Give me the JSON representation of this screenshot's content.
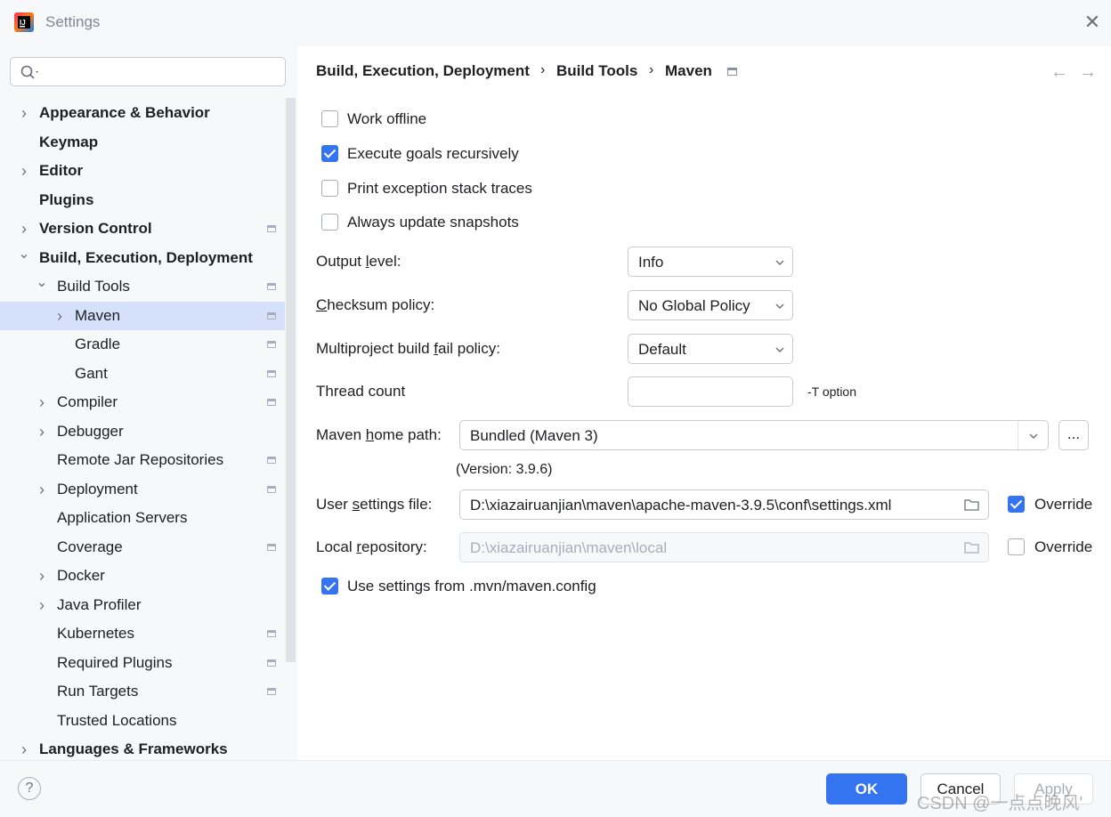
{
  "window": {
    "title": "Settings"
  },
  "search": {
    "placeholder": ""
  },
  "sidebar": {
    "items": [
      {
        "label": "Appearance & Behavior",
        "bold": true,
        "chevron": "right"
      },
      {
        "label": "Keymap",
        "bold": true
      },
      {
        "label": "Editor",
        "bold": true,
        "chevron": "right"
      },
      {
        "label": "Plugins",
        "bold": true
      },
      {
        "label": "Version Control",
        "bold": true,
        "chevron": "right"
      },
      {
        "label": "Build, Execution, Deployment",
        "bold": true,
        "chevron": "down"
      },
      {
        "label": "Build Tools",
        "chevron": "down"
      },
      {
        "label": "Maven",
        "chevron": "right",
        "selected": true
      },
      {
        "label": "Gradle"
      },
      {
        "label": "Gant"
      },
      {
        "label": "Compiler",
        "chevron": "right"
      },
      {
        "label": "Debugger",
        "chevron": "right"
      },
      {
        "label": "Remote Jar Repositories"
      },
      {
        "label": "Deployment",
        "chevron": "right"
      },
      {
        "label": "Application Servers"
      },
      {
        "label": "Coverage"
      },
      {
        "label": "Docker",
        "chevron": "right"
      },
      {
        "label": "Java Profiler",
        "chevron": "right"
      },
      {
        "label": "Kubernetes"
      },
      {
        "label": "Required Plugins"
      },
      {
        "label": "Run Targets"
      },
      {
        "label": "Trusted Locations"
      },
      {
        "label": "Languages & Frameworks",
        "bold": true,
        "chevron": "right"
      }
    ]
  },
  "breadcrumb": {
    "parts": [
      "Build, Execution, Deployment",
      "Build Tools",
      "Maven"
    ],
    "separator": "›"
  },
  "options": {
    "work_offline": {
      "label": "Work offline",
      "checked": false
    },
    "execute_goals": {
      "label": "Execute goals recursively",
      "checked": true
    },
    "print_exception": {
      "label": "Print exception stack traces",
      "checked": false
    },
    "always_update": {
      "label": "Always update snapshots",
      "checked": false
    }
  },
  "output_level": {
    "label_pre": "Output ",
    "label_u": "l",
    "label_post": "evel:",
    "value": "Info"
  },
  "checksum_policy": {
    "label_pre": "",
    "label_u": "C",
    "label_post": "hecksum policy:",
    "value": "No Global Policy"
  },
  "multiproject": {
    "label_pre": "Multiproject build ",
    "label_u": "f",
    "label_post": "ail policy:",
    "value": "Default"
  },
  "thread_count": {
    "label": "Thread count",
    "value": "",
    "hint": "-T option"
  },
  "maven_home": {
    "label_pre": "Maven ",
    "label_u": "h",
    "label_post": "ome path:",
    "value": "Bundled (Maven 3)",
    "browse": "...",
    "version": "(Version: 3.9.6)"
  },
  "user_settings": {
    "label_pre": "User ",
    "label_u": "s",
    "label_post": "ettings file:",
    "value": "D:\\xiazairuanjian\\maven\\apache-maven-3.9.5\\conf\\settings.xml",
    "override_label": "Override",
    "override_checked": true
  },
  "local_repo": {
    "label_pre": "Local ",
    "label_u": "r",
    "label_post": "epository:",
    "value": "D:\\xiazairuanjian\\maven\\local",
    "override_label": "Override",
    "override_checked": false
  },
  "use_mvn_config": {
    "label": "Use settings from .mvn/maven.config",
    "checked": true
  },
  "footer": {
    "help": "?",
    "ok": "OK",
    "cancel": "Cancel",
    "apply": "Apply"
  },
  "watermark": "CSDN @一点点晚风'",
  "colors": {
    "accent": "#3574f0",
    "selection": "#d5e1fb",
    "panel": "#f7f8fa"
  }
}
